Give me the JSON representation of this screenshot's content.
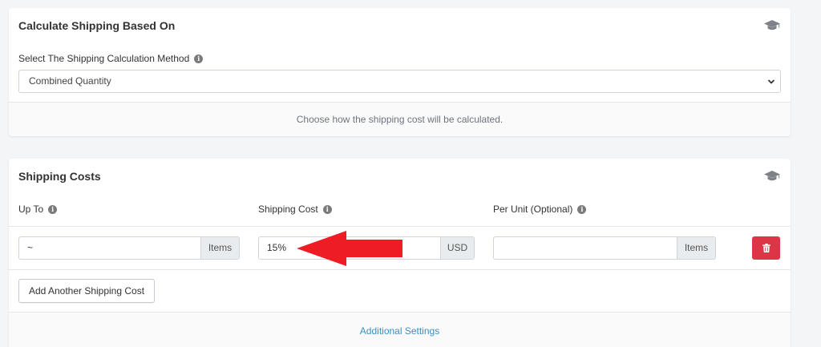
{
  "colors": {
    "page_bg": "#f4f5f7",
    "card_bg": "#ffffff",
    "link": "#3a8fc3",
    "danger": "#dc3545",
    "arrow": "#ee1d23"
  },
  "icons": {
    "card_header": "graduation-cap-icon",
    "info": "info-circle-icon",
    "select": "chevron-down-icon",
    "delete": "trash-icon"
  },
  "calc_section": {
    "title": "Calculate Shipping Based On",
    "method_label": "Select The Shipping Calculation Method",
    "method_value": "Combined Quantity",
    "footer_text": "Choose how the shipping cost will be calculated."
  },
  "costs_section": {
    "title": "Shipping Costs",
    "columns": {
      "up_to": "Up To",
      "shipping_cost": "Shipping Cost",
      "per_unit": "Per Unit (Optional)"
    },
    "rows": [
      {
        "up_to_value": "~",
        "up_to_unit": "Items",
        "cost_value": "15%",
        "cost_unit": "USD",
        "per_unit_value": "",
        "per_unit_unit": "Items"
      }
    ],
    "add_button_label": "Add Another Shipping Cost",
    "footer_link": "Additional Settings"
  }
}
